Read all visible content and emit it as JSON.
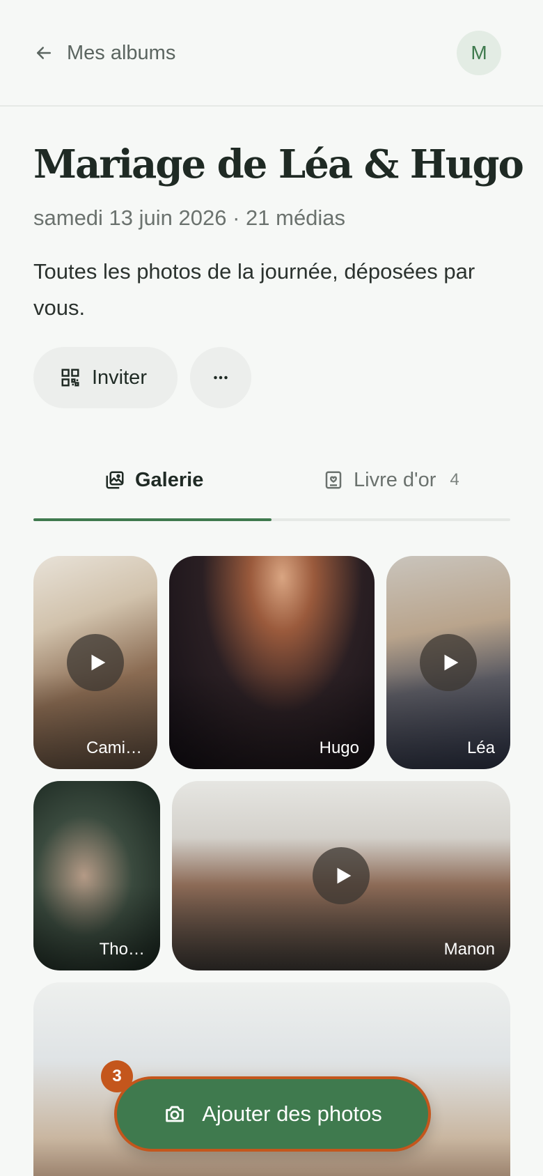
{
  "header": {
    "back_label": "Mes albums",
    "avatar_initial": "M"
  },
  "album": {
    "title": "Mariage de Léa & Hugo",
    "meta": "samedi 13 juin 2026 · 21 médias",
    "description": "Toutes les photos de la journée, déposées par vous."
  },
  "actions": {
    "invite_label": "Inviter",
    "more_icon": "more-horizontal-icon"
  },
  "tabs": [
    {
      "label": "Galerie",
      "icon": "gallery-icon",
      "active": true
    },
    {
      "label": "Livre d'or",
      "icon": "guestbook-icon",
      "count": "4",
      "active": false
    }
  ],
  "gallery": [
    {
      "author": "Cami…",
      "is_video": true
    },
    {
      "author": "Hugo",
      "is_video": false
    },
    {
      "author": "Léa",
      "is_video": true
    },
    {
      "author": "Tho…",
      "is_video": false
    },
    {
      "author": "Manon",
      "is_video": true
    },
    {
      "author": "",
      "is_video": false
    }
  ],
  "upload": {
    "label": "Ajouter des photos",
    "pending_count": "3",
    "icon": "camera-icon"
  },
  "colors": {
    "accent": "#3f7a4e",
    "highlight": "#c4561c",
    "background": "#f6f8f6"
  }
}
